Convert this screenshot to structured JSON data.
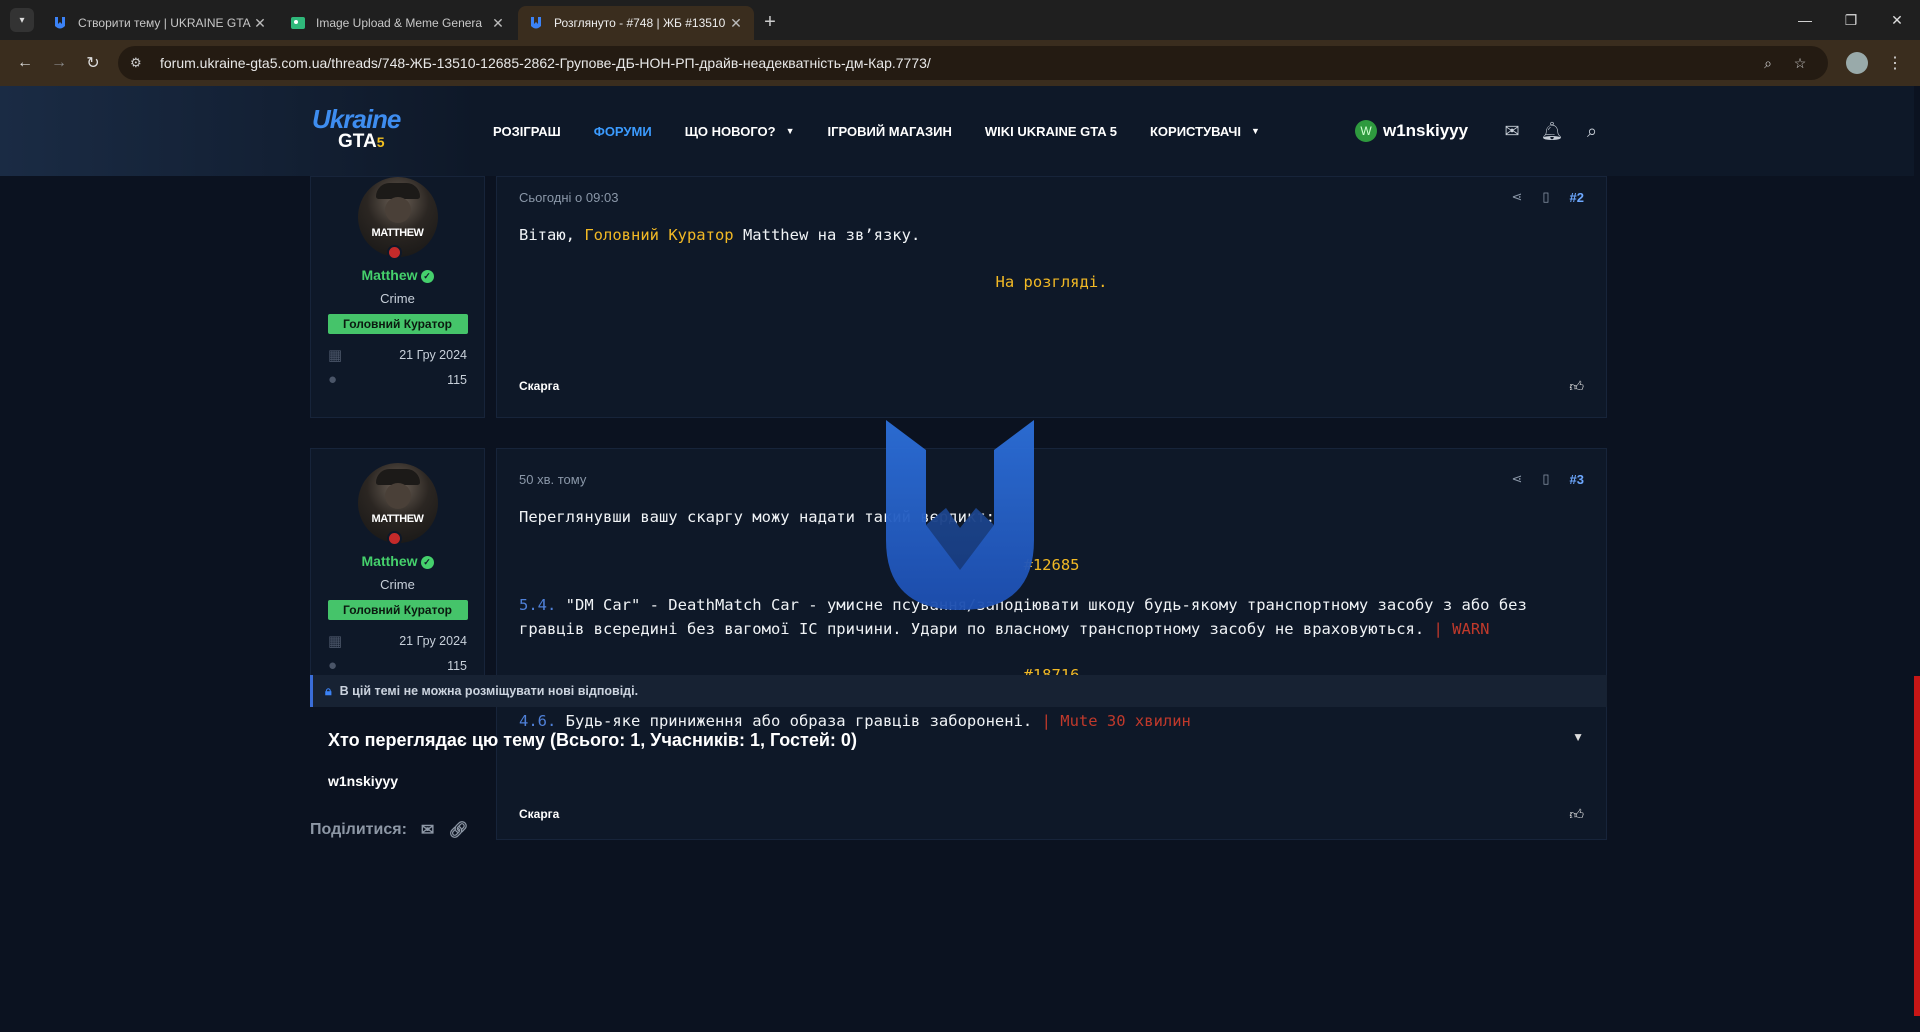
{
  "browser": {
    "tabs": [
      {
        "title": "Створити тему | UKRAINE GTA",
        "active": false
      },
      {
        "title": "Image Upload & Meme Genera",
        "active": false
      },
      {
        "title": "Розглянуто - #748 | ЖБ #13510",
        "active": true
      }
    ],
    "url": "forum.ukraine-gta5.com.ua/threads/748-ЖБ-13510-12685-2862-Групове-ДБ-НОН-РП-драйв-неадекватність-дм-Кар.7773/"
  },
  "site": {
    "logo_line1": "Ukraine",
    "logo_line2": "GTA",
    "logo_num": "5",
    "nav": [
      {
        "label": "РОЗІГРАШ",
        "active": false,
        "caret": false
      },
      {
        "label": "ФОРУМИ",
        "active": true,
        "caret": false
      },
      {
        "label": "ЩО НОВОГО?",
        "active": false,
        "caret": true
      },
      {
        "label": "ІГРОВИЙ МАГАЗИН",
        "active": false,
        "caret": false
      },
      {
        "label": "WIKI UKRAINE GTA 5",
        "active": false,
        "caret": false
      },
      {
        "label": "КОРИСТУВАЧІ",
        "active": false,
        "caret": true
      }
    ],
    "user": {
      "initial": "W",
      "name": "w1nskiyyy"
    }
  },
  "posts": [
    {
      "author": "Matthew",
      "avatar_text": "MATTHEW",
      "user_title": "Crime",
      "rank": "Головний Куратор",
      "joined": "21 Гру 2024",
      "messages": "115",
      "date": "Сьогодні о 09:03",
      "number": "#2",
      "greeting_pre": "Вітаю, ",
      "greeting_role": "Головний Куратор",
      "greeting_post": " Matthew на зв’язку.",
      "status": "На розгляді.",
      "report": "Скарга"
    },
    {
      "author": "Matthew",
      "avatar_text": "MATTHEW",
      "user_title": "Crime",
      "rank": "Головний Куратор",
      "joined": "21 Гру 2024",
      "messages": "115",
      "date": "50 хв. тому",
      "number": "#3",
      "intro": "Переглянувши вашу скаргу можу надати такий вердикт:",
      "id1": "#12685",
      "rule1_num": "5.4.",
      "rule1_text": " \"DM Car\" - DeathMatch Car - умисне псування/заподіювати шкоду будь-якому транспортному засобу з або без гравців всередині без вагомої IC причини. Удари по власному транспортному засобу не враховуються.",
      "rule1_penalty": " | WARN",
      "id2": "#18716",
      "rule2_num": "4.6.",
      "rule2_text": " Будь-яке приниження або образа гравців заборонені.",
      "rule2_penalty": " | Mute 30 хвилин",
      "report": "Скарга"
    }
  ],
  "locked_notice": "В цій темі не можна розміщувати нові відповіді.",
  "viewers": {
    "title": "Хто переглядає цю тему (Всього: 1, Учасників: 1, Гостей: 0)",
    "users": "w1nskiyyy"
  },
  "share_label": "Поділитися:",
  "colors": {
    "accent": "#3b9bff",
    "rank": "#45c46a",
    "gold": "#f2b925",
    "warn": "#c0392b"
  }
}
